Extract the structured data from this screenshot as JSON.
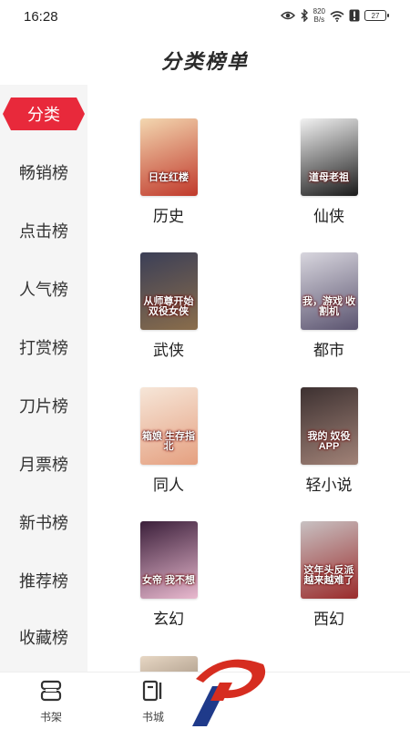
{
  "status": {
    "time": "16:28",
    "net_speed_top": "820",
    "net_speed_bottom": "B/s",
    "battery": "27",
    "icons": [
      "eye-icon",
      "bluetooth-icon",
      "wifi-icon",
      "alert-icon",
      "battery-icon"
    ]
  },
  "header": {
    "title": "分类榜单"
  },
  "sidebar": {
    "active_color": "#e8293b",
    "items": [
      {
        "label": "分类",
        "active": true
      },
      {
        "label": "畅销榜"
      },
      {
        "label": "点击榜"
      },
      {
        "label": "人气榜"
      },
      {
        "label": "打赏榜"
      },
      {
        "label": "刀片榜"
      },
      {
        "label": "月票榜"
      },
      {
        "label": "新书榜"
      },
      {
        "label": "推荐榜"
      },
      {
        "label": "收藏榜"
      }
    ]
  },
  "categories": [
    {
      "name": "历史",
      "cover_title": "日在红楼",
      "colors": [
        "#f3d7b0",
        "#c0392b"
      ]
    },
    {
      "name": "仙侠",
      "cover_title": "道母老祖",
      "colors": [
        "#f2f2f2",
        "#1a1a1a"
      ]
    },
    {
      "name": "武侠",
      "cover_title": "从师尊开始 双役女侠",
      "colors": [
        "#3b3f57",
        "#8a6d4b"
      ]
    },
    {
      "name": "都市",
      "cover_title": "我，游戏 收割机",
      "colors": [
        "#d8d6de",
        "#5b5470"
      ]
    },
    {
      "name": "同人",
      "cover_title": "箱娘 生存指北",
      "colors": [
        "#f6e6d8",
        "#e5a080"
      ]
    },
    {
      "name": "轻小说",
      "cover_title": "我的 奴役APP",
      "colors": [
        "#3d3131",
        "#a18277"
      ]
    },
    {
      "name": "玄幻",
      "cover_title": "女帝 我不想",
      "colors": [
        "#3b1f3a",
        "#e9b9cf"
      ]
    },
    {
      "name": "西幻",
      "cover_title": "这年头反派 越来越难了",
      "colors": [
        "#c8c1c2",
        "#9a2b2b"
      ]
    },
    {
      "name": "",
      "cover_title": "",
      "colors": [
        "#e7d7c4",
        "#6d5a49"
      ]
    }
  ],
  "bottom_nav": {
    "items": [
      {
        "label": "书架",
        "icon": "bookshelf-icon"
      },
      {
        "label": "书城",
        "icon": "bookstore-icon"
      }
    ]
  },
  "brand": {
    "colors": [
      "#d62d20",
      "#1f3a8a"
    ]
  }
}
